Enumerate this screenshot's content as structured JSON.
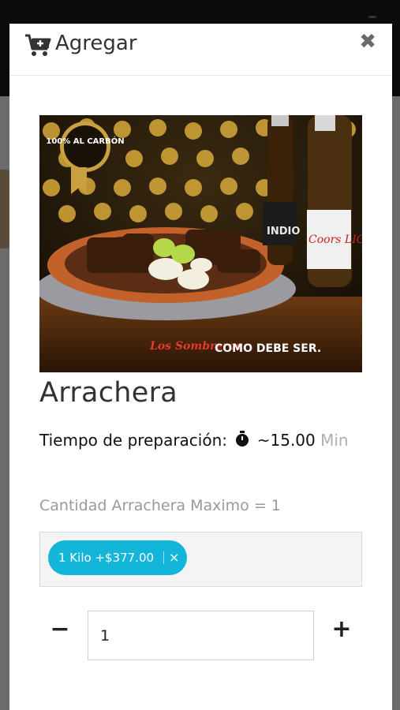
{
  "modal": {
    "title": "Agregar",
    "close_label": "✖"
  },
  "product": {
    "name": "Arrachera",
    "image_badge": "100% AL CARBÓN",
    "image_brand": "Los Sombreros",
    "image_slogan": "COMO DEBE SER.",
    "image_beer_1": "INDIO",
    "image_beer_2": "Coors LIGHT"
  },
  "prep": {
    "label": "Tiempo de preparación:",
    "value": "~15.00",
    "unit": "Min"
  },
  "quantity": {
    "label": "Cantidad Arrachera Maximo = 1",
    "selected_option": "1 Kilo +$377.00",
    "remove_label": "×",
    "minus_label": "−",
    "plus_label": "+",
    "value": "1"
  },
  "colors": {
    "chip": "#13b5d9",
    "backdrop": "#6b6b6b"
  }
}
